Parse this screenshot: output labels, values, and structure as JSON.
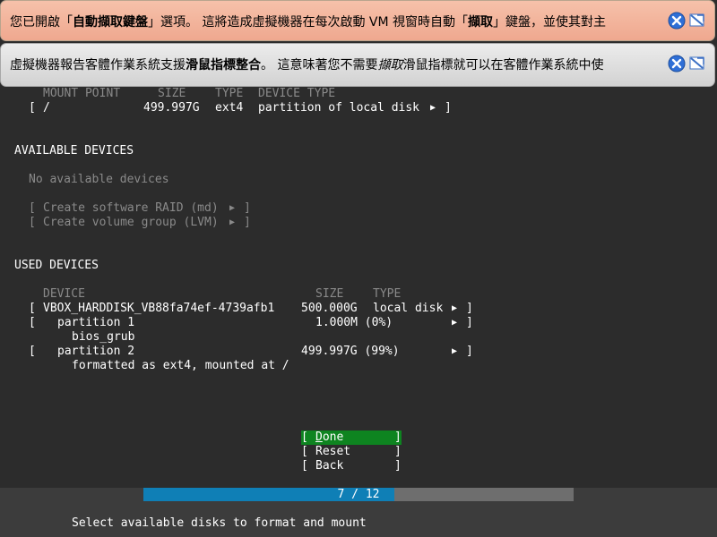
{
  "banners": {
    "keyboard": {
      "text_1": "您已開啟「",
      "bold_1": "自動擷取鍵盤",
      "text_2": "」選項。 這將造成虛擬機器在每次啟動 VM 視窗時自動「",
      "bold_2": "擷取",
      "text_3": "」鍵盤，並使其對主"
    },
    "mouse": {
      "text_1": "虛擬機器報告客體作業系統支援",
      "bold_1": "滑鼠指標整合",
      "text_2": "。 這意味著您不需要",
      "italic_1": "擷取",
      "text_3": "滑鼠指標就可以在客體作業系統中使"
    }
  },
  "mounted": {
    "header": {
      "mount_point": "MOUNT POINT",
      "size": "SIZE",
      "type": "TYPE",
      "device_type": "DEVICE TYPE"
    },
    "rows": [
      {
        "mount_point": "/",
        "size": "499.997G",
        "type": "ext4",
        "device_type": "partition of local disk"
      }
    ]
  },
  "available": {
    "title": "AVAILABLE DEVICES",
    "empty_text": "No available devices",
    "actions": [
      "Create software RAID (md)",
      "Create volume group (LVM)"
    ]
  },
  "used": {
    "title": "USED DEVICES",
    "header": {
      "device": "DEVICE",
      "size": "SIZE",
      "type": "TYPE"
    },
    "disk": {
      "name": "VBOX_HARDDISK_VB88fa74ef-4739afb1",
      "size": "500.000G",
      "type": "local disk"
    },
    "partitions": [
      {
        "name": "partition 1",
        "size": "1.000M (0%)",
        "detail": "bios_grub"
      },
      {
        "name": "partition 2",
        "size": "499.997G (99%)",
        "detail": "formatted as ext4, mounted at /"
      }
    ]
  },
  "buttons": {
    "done": {
      "hotkey": "D",
      "rest": "one"
    },
    "reset": "Reset",
    "back": "Back"
  },
  "progress": {
    "label": "7 / 12",
    "current": 7,
    "total": 12
  },
  "hint": "Select available disks to format and mount",
  "colors": {
    "background": "#2c2c2c",
    "selected_button": "#0e8420",
    "progress_fill": "#0f7fb6",
    "progress_track": "#6e6e6e",
    "dim_text": "#8a8a8a"
  },
  "icons": {
    "close": "close-icon",
    "pin": "pin-icon",
    "submenu": "triangle-right-icon"
  }
}
